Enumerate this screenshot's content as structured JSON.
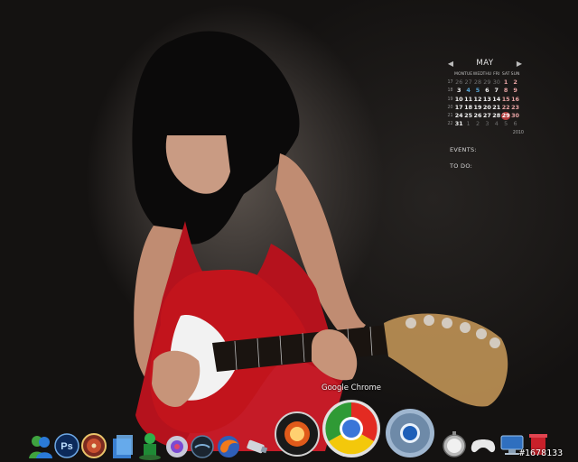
{
  "calendar": {
    "month": "MAY",
    "prev_arrow": "◀",
    "next_arrow": "▶",
    "weekday_headers": [
      "MON",
      "TUE",
      "WED",
      "THU",
      "FRI",
      "SAT",
      "SUN"
    ],
    "weeks": [
      {
        "week": "17",
        "days": [
          "26",
          "27",
          "28",
          "29",
          "30",
          "1",
          "2"
        ]
      },
      {
        "week": "18",
        "days": [
          "3",
          "4",
          "5",
          "6",
          "7",
          "8",
          "9"
        ]
      },
      {
        "week": "19",
        "days": [
          "10",
          "11",
          "12",
          "13",
          "14",
          "15",
          "16"
        ]
      },
      {
        "week": "20",
        "days": [
          "17",
          "18",
          "19",
          "20",
          "21",
          "22",
          "23"
        ]
      },
      {
        "week": "21",
        "days": [
          "24",
          "25",
          "26",
          "27",
          "28",
          "29",
          "30"
        ]
      },
      {
        "week": "22",
        "days": [
          "31",
          "1",
          "2",
          "3",
          "4",
          "5",
          "6"
        ]
      }
    ],
    "year": "2010"
  },
  "widgets": {
    "events_label": "EVENTS:",
    "todo_label": "TO DO:"
  },
  "dock": {
    "hover_label": "Google Chrome",
    "icons": [
      {
        "name": "messenger-icon"
      },
      {
        "name": "photoshop-icon",
        "text": "Ps"
      },
      {
        "name": "cd-burner-icon"
      },
      {
        "name": "file-manager-icon"
      },
      {
        "name": "green-figure-icon"
      },
      {
        "name": "media-player-icon"
      },
      {
        "name": "dark-orb-icon"
      },
      {
        "name": "firefox-icon"
      },
      {
        "name": "usb-drive-icon"
      },
      {
        "name": "fire-orb-icon"
      },
      {
        "name": "chrome-icon"
      },
      {
        "name": "chrome-dark-icon"
      },
      {
        "name": "clock-icon"
      },
      {
        "name": "gamepad-icon"
      },
      {
        "name": "computer-icon"
      },
      {
        "name": "recycle-bin-icon"
      }
    ]
  },
  "watermark": "#1678133"
}
